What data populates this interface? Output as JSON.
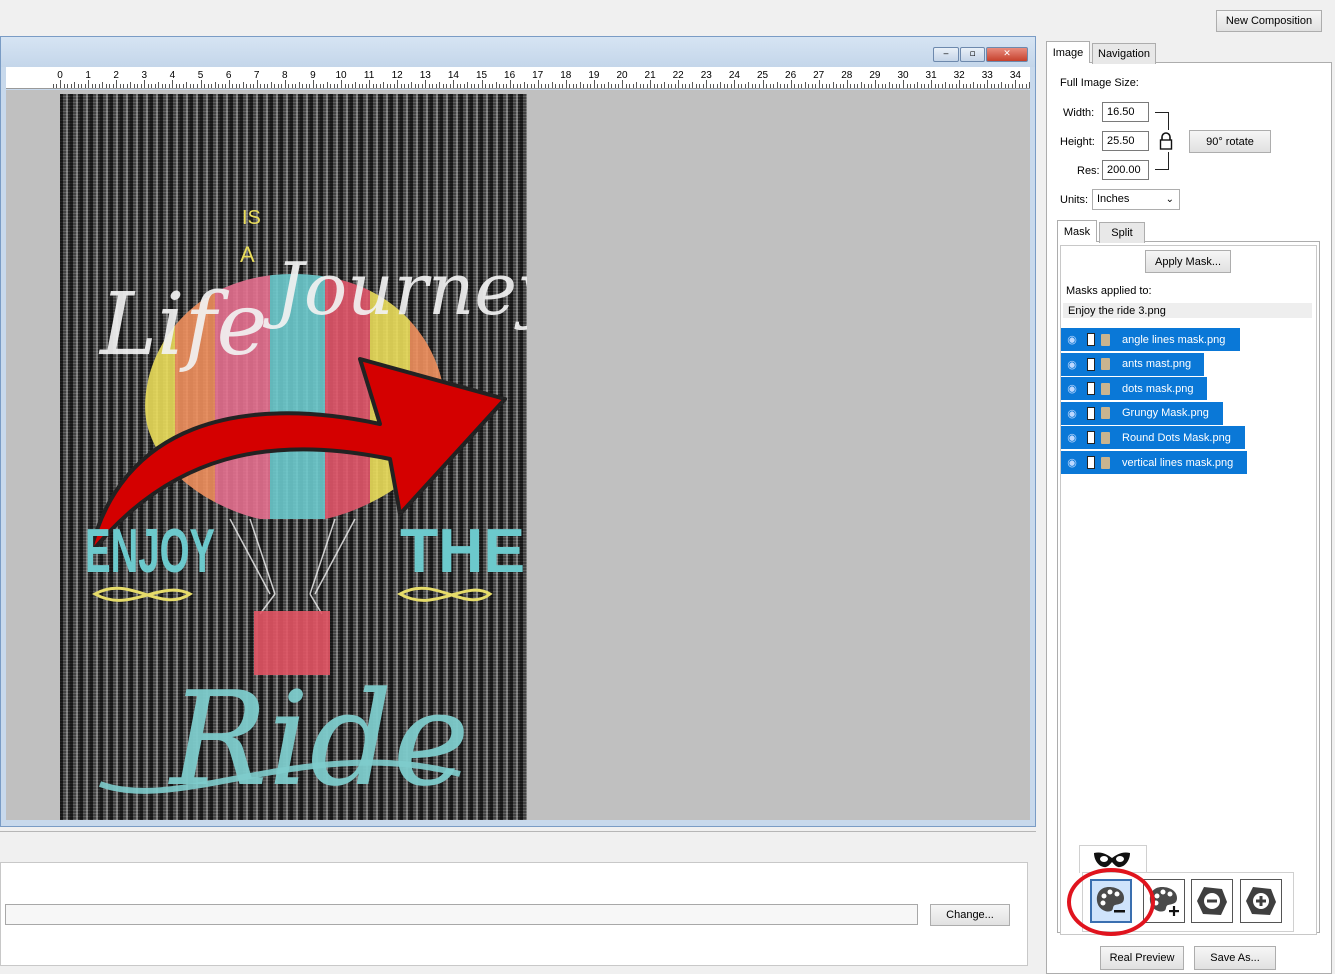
{
  "top": {
    "new_composition": "New Composition"
  },
  "window": {
    "min_glyph": "‒",
    "max_glyph": "▫",
    "close_glyph": "✕"
  },
  "ruler": {
    "labels": [
      "0",
      "1",
      "2",
      "3",
      "4",
      "5",
      "6",
      "7",
      "8",
      "9",
      "10",
      "11",
      "12",
      "13",
      "14",
      "15",
      "16",
      "17",
      "18",
      "19",
      "20",
      "21",
      "22",
      "23",
      "24",
      "25",
      "26",
      "27",
      "28",
      "29",
      "30",
      "31",
      "32",
      "33",
      "34"
    ]
  },
  "right_panel": {
    "tabs": [
      "Image",
      "Navigation"
    ],
    "full_image_size": "Full Image Size:",
    "width_label": "Width:",
    "width_value": "16.50",
    "height_label": "Height:",
    "height_value": "25.50",
    "res_label": "Res:",
    "res_value": "200.00",
    "rotate": "90° rotate",
    "units_label": "Units:",
    "units_value": "Inches",
    "sub_tabs": [
      "Mask",
      "Split"
    ],
    "apply_mask": "Apply Mask...",
    "masks_applied_to": "Masks applied to:",
    "target_file": "Enjoy the ride 3.png",
    "masks": [
      "angle lines mask.png",
      "ants mast.png",
      "dots mask.png",
      "Grungy Mask.png",
      "Round Dots Mask.png",
      "vertical lines mask.png"
    ],
    "real_preview": "Real Preview",
    "save_as": "Save As..."
  },
  "bottom": {
    "change": "Change..."
  },
  "artwork_text": {
    "life": "Life",
    "is": "IS",
    "a": "A",
    "journey": "Journey",
    "enjoy": "ENJOY",
    "the": "THE",
    "ride": "Ride"
  },
  "colors": {
    "selection": "#0a78d7",
    "highlight_circle": "#e0141e",
    "arrow": "#d40000",
    "balloon_pink": "#e5708f",
    "balloon_cyan": "#6cc9cc",
    "balloon_yellow": "#e9dc5a",
    "balloon_orange": "#ef8f5e",
    "ride_text": "#7ecccc"
  }
}
